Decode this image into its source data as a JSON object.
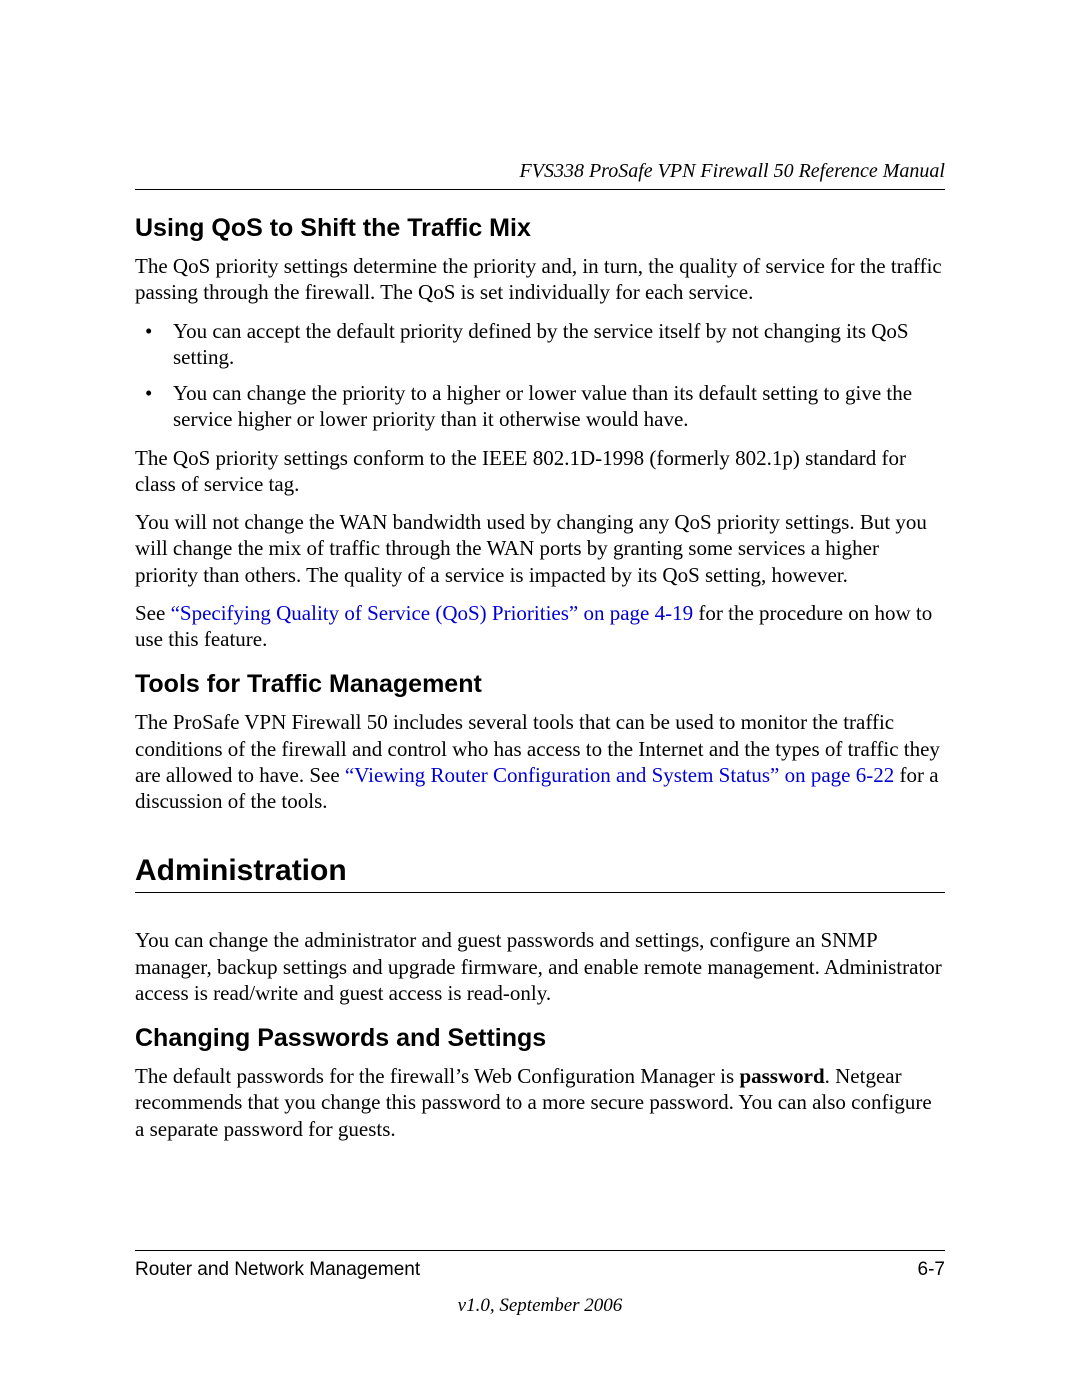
{
  "header": {
    "manual_title": "FVS338 ProSafe VPN Firewall 50 Reference Manual"
  },
  "sections": {
    "qos": {
      "heading": "Using QoS to Shift the Traffic Mix",
      "intro": "The QoS priority settings determine the priority and, in turn, the quality of service for the traffic passing through the firewall. The QoS is set individually for each service.",
      "bullets": [
        "You can accept the default priority defined by the service itself by not changing its QoS setting.",
        "You can change the priority to a higher or lower value than its default setting to give the service higher or lower priority than it otherwise would have."
      ],
      "p_conform": "The QoS priority settings conform to the IEEE 802.1D-1998 (formerly 802.1p) standard for class of service tag.",
      "p_mix": "You will not change the WAN bandwidth used by changing any QoS priority settings. But you will change the mix of traffic through the WAN ports by granting some services a higher priority than others. The quality of a service is impacted by its QoS setting, however.",
      "see_prefix": "See ",
      "see_link": "“Specifying Quality of Service (QoS) Priorities” on page 4-19",
      "see_suffix": " for the procedure on how to use this feature."
    },
    "tools": {
      "heading": "Tools for Traffic Management",
      "p_prefix": "The ProSafe VPN Firewall 50 includes several tools that can be used to monitor the traffic conditions of the firewall and control who has access to the Internet and the types of traffic they are allowed to have. See ",
      "p_link": "“Viewing Router Configuration and System Status” on page 6-22",
      "p_suffix": " for a discussion of the tools."
    },
    "admin": {
      "heading": "Administration",
      "intro": "You can change the administrator and guest passwords and settings, configure an SNMP manager, backup settings and upgrade firmware, and enable remote management. Administrator access is read/write and guest access is read-only."
    },
    "passwords": {
      "heading": "Changing Passwords and Settings",
      "p_prefix": "The default passwords for the firewall’s Web Configuration Manager is ",
      "p_bold": "password",
      "p_suffix": ". Netgear recommends that you change this password to a more secure password. You can also configure a separate password for guests."
    }
  },
  "footer": {
    "chapter": "Router and Network Management",
    "page_number": "6-7",
    "version": "v1.0, September 2006"
  }
}
